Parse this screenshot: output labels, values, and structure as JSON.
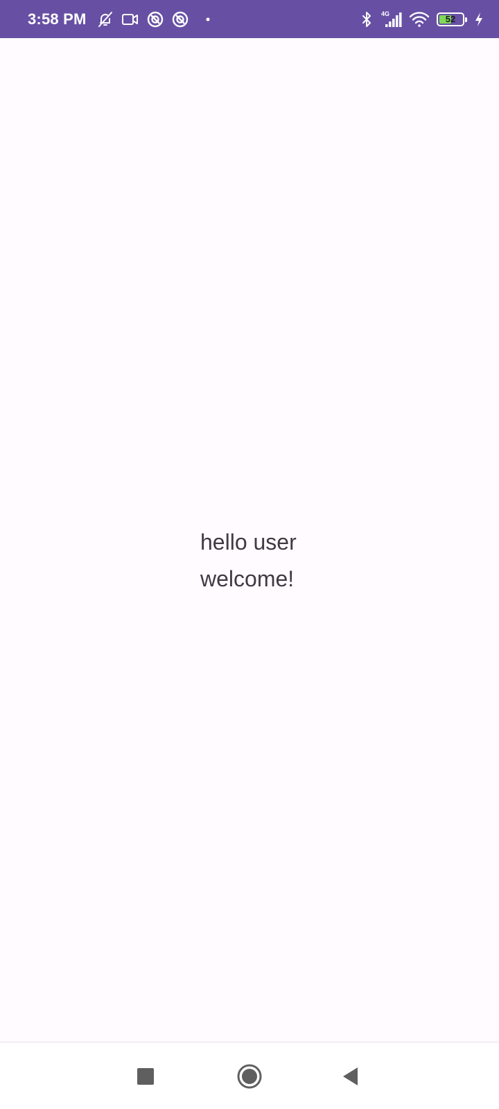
{
  "status_bar": {
    "time": "3:58 PM",
    "network_type": "4G",
    "battery_level": "52",
    "battery_fraction": 0.52,
    "background_color": "#6750a4",
    "left_icons": [
      "bell-off-icon",
      "video-camera-icon",
      "circle-slash-icon",
      "circle-slash-icon",
      "dot-icon"
    ],
    "right_icons": [
      "bluetooth-icon",
      "cellular-signal-icon",
      "wifi-icon",
      "battery-icon",
      "charging-bolt-icon"
    ]
  },
  "main": {
    "greeting_line1": "hello user",
    "greeting_line2": "welcome!",
    "text_color": "#3f3a44",
    "background_color": "#fffbfe"
  },
  "nav_bar": {
    "buttons": [
      "recents-square-icon",
      "home-circle-icon",
      "back-triangle-icon"
    ],
    "icon_color": "#5f5f5f"
  }
}
